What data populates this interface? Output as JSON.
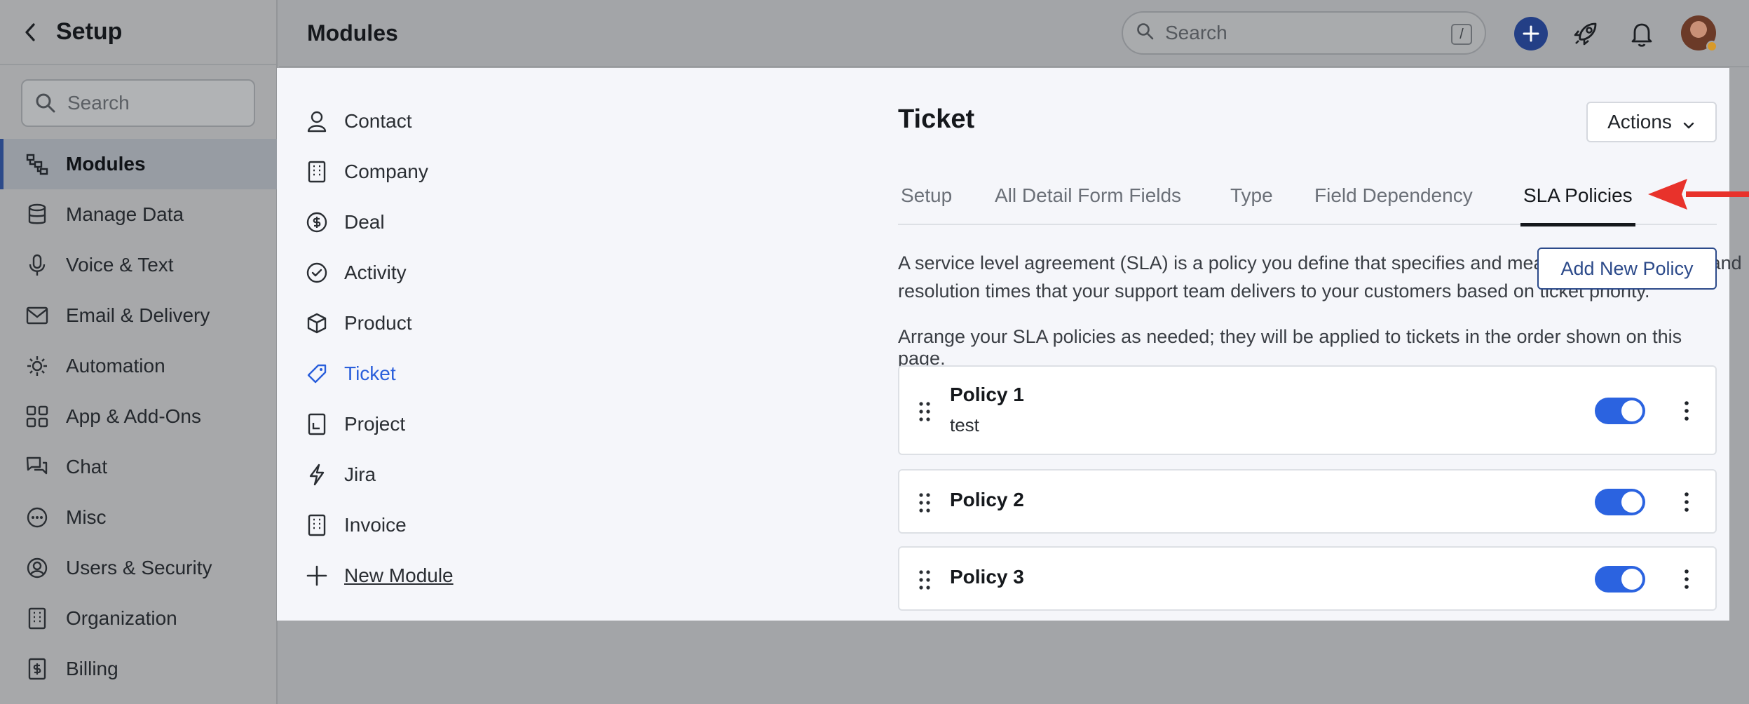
{
  "setup": {
    "title": "Setup",
    "search_placeholder": "Search",
    "nav": [
      {
        "label": "Modules",
        "icon": "hierarchy-icon",
        "active": true
      },
      {
        "label": "Manage Data",
        "icon": "database-icon"
      },
      {
        "label": "Voice & Text",
        "icon": "microphone-icon"
      },
      {
        "label": "Email & Delivery",
        "icon": "envelope-icon"
      },
      {
        "label": "Automation",
        "icon": "automation-gear-icon"
      },
      {
        "label": "App & Add-Ons",
        "icon": "grid-icon"
      },
      {
        "label": "Chat",
        "icon": "chat-bubbles-icon"
      },
      {
        "label": "Misc",
        "icon": "ellipsis-circle-icon"
      },
      {
        "label": "Users & Security",
        "icon": "user-circle-icon"
      },
      {
        "label": "Organization",
        "icon": "building-icon"
      },
      {
        "label": "Billing",
        "icon": "receipt-icon"
      }
    ]
  },
  "topbar": {
    "page_title": "Modules",
    "search_placeholder": "Search",
    "search_shortcut": "/"
  },
  "modules": {
    "items": [
      {
        "label": "Contact",
        "icon": "person-icon"
      },
      {
        "label": "Company",
        "icon": "building-icon"
      },
      {
        "label": "Deal",
        "icon": "dollar-circle-icon"
      },
      {
        "label": "Activity",
        "icon": "check-circle-icon"
      },
      {
        "label": "Product",
        "icon": "box-icon"
      },
      {
        "label": "Ticket",
        "icon": "ticket-icon",
        "active": true
      },
      {
        "label": "Project",
        "icon": "project-icon"
      },
      {
        "label": "Jira",
        "icon": "lightning-icon"
      },
      {
        "label": "Invoice",
        "icon": "invoice-icon"
      }
    ],
    "new_module_label": "New Module"
  },
  "ticket": {
    "title": "Ticket",
    "actions_label": "Actions",
    "tabs": [
      "Setup",
      "All Detail Form Fields",
      "Type",
      "Field Dependency",
      "SLA Policies"
    ],
    "active_tab": "SLA Policies",
    "description": "A service level agreement (SLA) is a policy you define that specifies and measures the response and resolution times that your support team delivers to your customers based on ticket priority.",
    "add_policy_label": "Add New Policy",
    "arrange_note": "Arrange your SLA policies as needed; they will be applied to tickets in the order shown on this page.",
    "policies": [
      {
        "name": "Policy 1",
        "description": "test",
        "enabled": true
      },
      {
        "name": "Policy 2",
        "description": "",
        "enabled": true
      },
      {
        "name": "Policy 3",
        "description": "",
        "enabled": true
      }
    ]
  },
  "colors": {
    "accent": "#2b63e0",
    "active_link": "#2a5fdb",
    "brand_dark": "#2c4a8a",
    "annotation_arrow": "#e8322b"
  }
}
